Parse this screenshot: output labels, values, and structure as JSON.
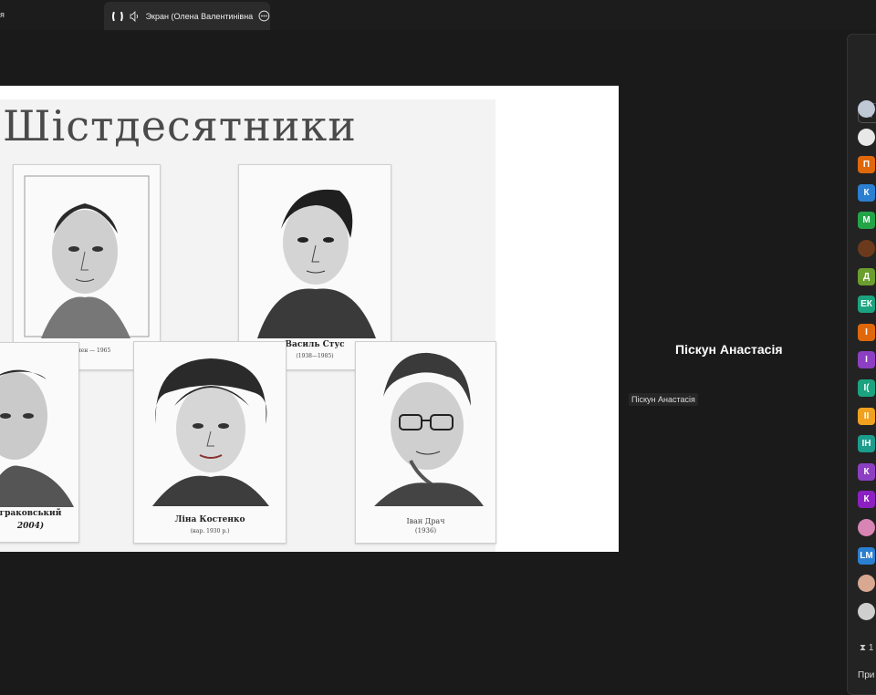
{
  "tabs": {
    "prev_label": "я",
    "active_label": "Экран (Олена Валентинівна"
  },
  "slide": {
    "title": "Шістдесятники",
    "captions": {
      "card1_note": "Свисмен — 1965",
      "card2_name": "Василь Стус",
      "card2_years": "(1938—1985)",
      "card3_name": "граковський",
      "card3_years": "2004)",
      "card4_name": "Ліна Костенко",
      "card4_years": "(нар. 1930 р.)",
      "card5_name": "Іван Драч",
      "card5_years": "(1936)"
    }
  },
  "participant": {
    "name": "Піскун Анастасія",
    "tag": "Піскун Анастасія"
  },
  "sidebar": {
    "avatars": [
      {
        "label": "",
        "color": "#bfc9d6"
      },
      {
        "label": "",
        "color": "#e8e8e8"
      },
      {
        "label": "П",
        "color": "#e0680c"
      },
      {
        "label": "К",
        "color": "#2b7fd0"
      },
      {
        "label": "М",
        "color": "#23a447"
      },
      {
        "label": "",
        "color": "#6b3a1c"
      },
      {
        "label": "Д",
        "color": "#6a9e2e"
      },
      {
        "label": "ЕК",
        "color": "#1ba37f"
      },
      {
        "label": "І",
        "color": "#e0680c"
      },
      {
        "label": "І",
        "color": "#8c3fc2"
      },
      {
        "label": "І(",
        "color": "#1ba37f"
      },
      {
        "label": "ІІ",
        "color": "#f0a11f"
      },
      {
        "label": "ІН",
        "color": "#1b9c8c"
      },
      {
        "label": "К",
        "color": "#8c3fc2"
      },
      {
        "label": "К",
        "color": "#8c1fc2"
      },
      {
        "label": "",
        "color": "#d884b4"
      },
      {
        "label": "LM",
        "color": "#2b7fd0"
      },
      {
        "label": "",
        "color": "#d8a890"
      },
      {
        "label": "",
        "color": "#cfcfcf"
      }
    ],
    "footer_time": "1",
    "footer_button": "При"
  }
}
